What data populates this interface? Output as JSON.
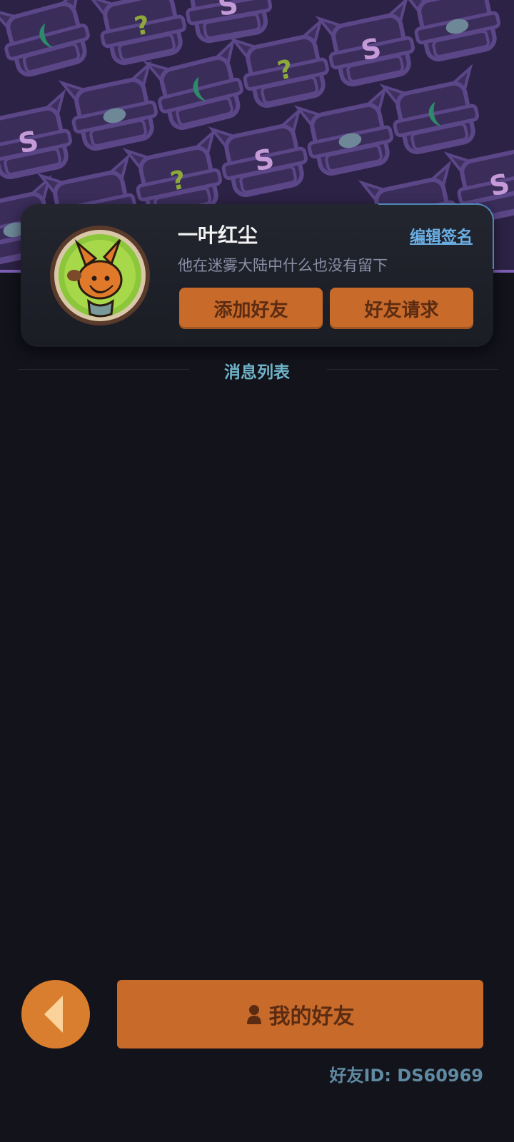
{
  "profile": {
    "username": "一叶红尘",
    "edit_signature_label": "编辑签名",
    "signature": "他在迷雾大陆中什么也没有留下",
    "add_friend_label": "添加好友",
    "friend_requests_label": "好友请求",
    "avatar_icon": "fox-avatar-icon"
  },
  "messages": {
    "title": "消息列表"
  },
  "footer": {
    "back_icon": "back-arrow-icon",
    "my_friends_label": "我的好友",
    "friend_icon": "person-icon",
    "friend_id_text": "好友ID: DS60969"
  },
  "colors": {
    "background": "#12131b",
    "header": "#2c2245",
    "accent_orange": "#c86a2a",
    "accent_cyan": "#6fb4c8",
    "link_blue": "#6ab0e6"
  }
}
